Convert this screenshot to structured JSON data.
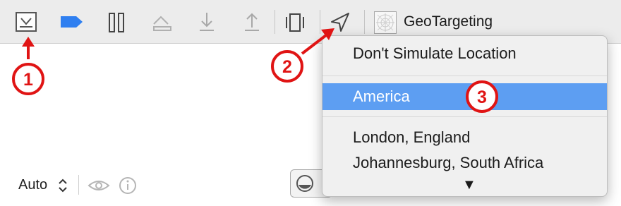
{
  "toolbar": {
    "buttons": [
      {
        "name": "hide-debug-area-button",
        "icon": "panel-toggle-icon"
      },
      {
        "name": "breakpoints-button",
        "icon": "breakpoint-icon",
        "color": "#2f7ff0"
      },
      {
        "name": "pause-button",
        "icon": "pause-icon"
      },
      {
        "name": "step-over-button",
        "icon": "step-over-icon"
      },
      {
        "name": "step-into-button",
        "icon": "step-into-icon"
      },
      {
        "name": "step-out-button",
        "icon": "step-out-icon"
      },
      {
        "name": "debug-view-hierarchy-button",
        "icon": "view-hierarchy-icon"
      },
      {
        "name": "simulate-location-button",
        "icon": "location-arrow-icon"
      }
    ],
    "scheme": {
      "label": "GeoTargeting",
      "icon": "app-icon"
    }
  },
  "location_menu": {
    "items": [
      {
        "label": "Don't Simulate Location",
        "selected": false
      },
      {
        "label": "America",
        "selected": true
      },
      {
        "label": "London, England",
        "selected": false
      },
      {
        "label": "Johannesburg, South Africa",
        "selected": false
      }
    ],
    "more_indicator": "▼",
    "selected_color": "#5d9ef2"
  },
  "bottom_bar": {
    "auto_label": "Auto",
    "icons": [
      "chevron-updown-icon",
      "eye-icon",
      "info-icon",
      "filter-icon"
    ]
  },
  "callouts": {
    "color": "#e01414",
    "labels": [
      "1",
      "2",
      "3"
    ]
  }
}
